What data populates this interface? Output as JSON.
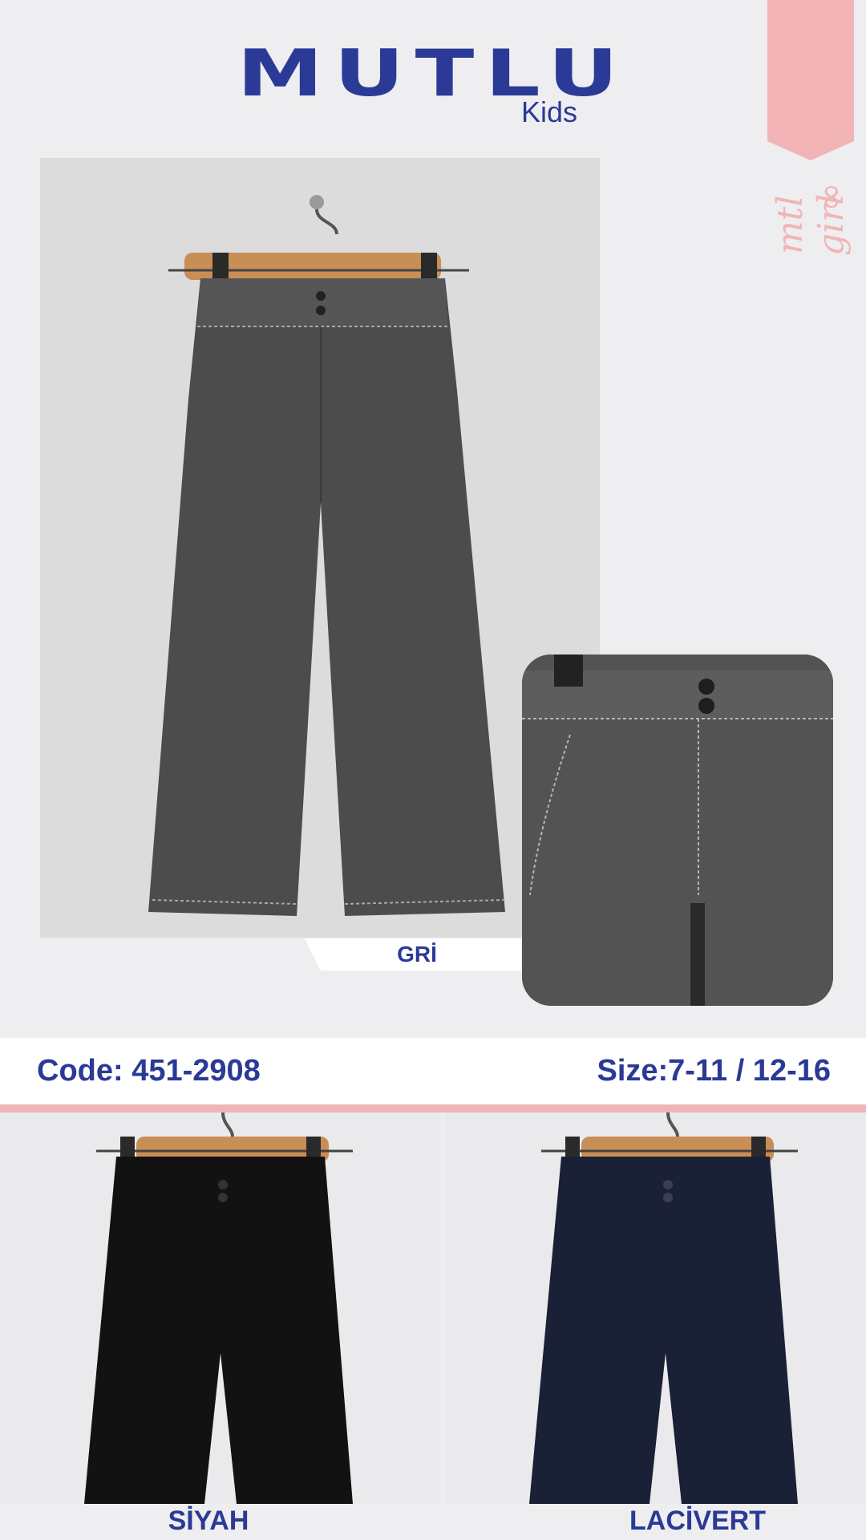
{
  "logo": {
    "brand": "MUTLU",
    "sub": "Kids"
  },
  "ribbon": {
    "text": "mtl girl"
  },
  "main_photo": {
    "caption": "GRİ"
  },
  "info": {
    "code": "Code: 451-2908",
    "size": "Size:7-11 / 12-16"
  },
  "variants": [
    {
      "label": "SİYAH"
    },
    {
      "label": "LACİVERT"
    }
  ],
  "colors": {
    "brand": "#2a3a96",
    "pink": "#f0b5b7",
    "gray": "#4f4f4f",
    "black": "#111111",
    "navy": "#1a2036"
  }
}
